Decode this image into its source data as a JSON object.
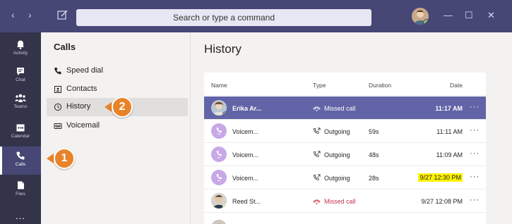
{
  "titlebar": {
    "search_placeholder": "Search or type a command",
    "back_arrow": "‹",
    "forward_arrow": "›",
    "minimize": "—",
    "maximize": "☐",
    "close": "✕"
  },
  "rail": {
    "items": [
      {
        "label": "Activity",
        "icon": "bell-icon"
      },
      {
        "label": "Chat",
        "icon": "chat-icon"
      },
      {
        "label": "Teams",
        "icon": "teams-icon"
      },
      {
        "label": "Calendar",
        "icon": "calendar-icon"
      },
      {
        "label": "Calls",
        "icon": "phone-icon",
        "active": true
      },
      {
        "label": "Files",
        "icon": "file-icon"
      }
    ],
    "more": "..."
  },
  "calls_pane": {
    "title": "Calls",
    "items": [
      {
        "label": "Speed dial",
        "icon": "phone-icon"
      },
      {
        "label": "Contacts",
        "icon": "contacts-icon"
      },
      {
        "label": "History",
        "icon": "clock-icon",
        "selected": true
      },
      {
        "label": "Voicemail",
        "icon": "voicemail-icon"
      }
    ]
  },
  "main": {
    "title": "History",
    "columns": [
      "Name",
      "Type",
      "Duration",
      "Date"
    ],
    "rows": [
      {
        "name": "Erika Ar...",
        "type": "Missed call",
        "missed": true,
        "duration": "",
        "date": "11:17 AM",
        "avatar": "photo",
        "selected": true
      },
      {
        "name": "Voicem...",
        "type": "Outgoing",
        "missed": false,
        "duration": "59s",
        "date": "11:11 AM",
        "avatar": "voicemail"
      },
      {
        "name": "Voicem...",
        "type": "Outgoing",
        "missed": false,
        "duration": "48s",
        "date": "11:09 AM",
        "avatar": "voicemail"
      },
      {
        "name": "Voicem...",
        "type": "Outgoing",
        "missed": false,
        "duration": "28s",
        "date": "9/27 12:30 PM",
        "avatar": "voicemail",
        "date_highlighted": true
      },
      {
        "name": "Reed St...",
        "type": "Missed call",
        "missed": true,
        "duration": "",
        "date": "9/27 12:08 PM",
        "avatar": "photo"
      }
    ],
    "more_label": "···"
  },
  "callouts": [
    "1",
    "2"
  ],
  "colors": {
    "titlebar": "#464775",
    "rail": "#33344a",
    "accent": "#6264a7",
    "missed": "#c4314b",
    "callout": "#e8832a",
    "highlight": "#fff200"
  }
}
